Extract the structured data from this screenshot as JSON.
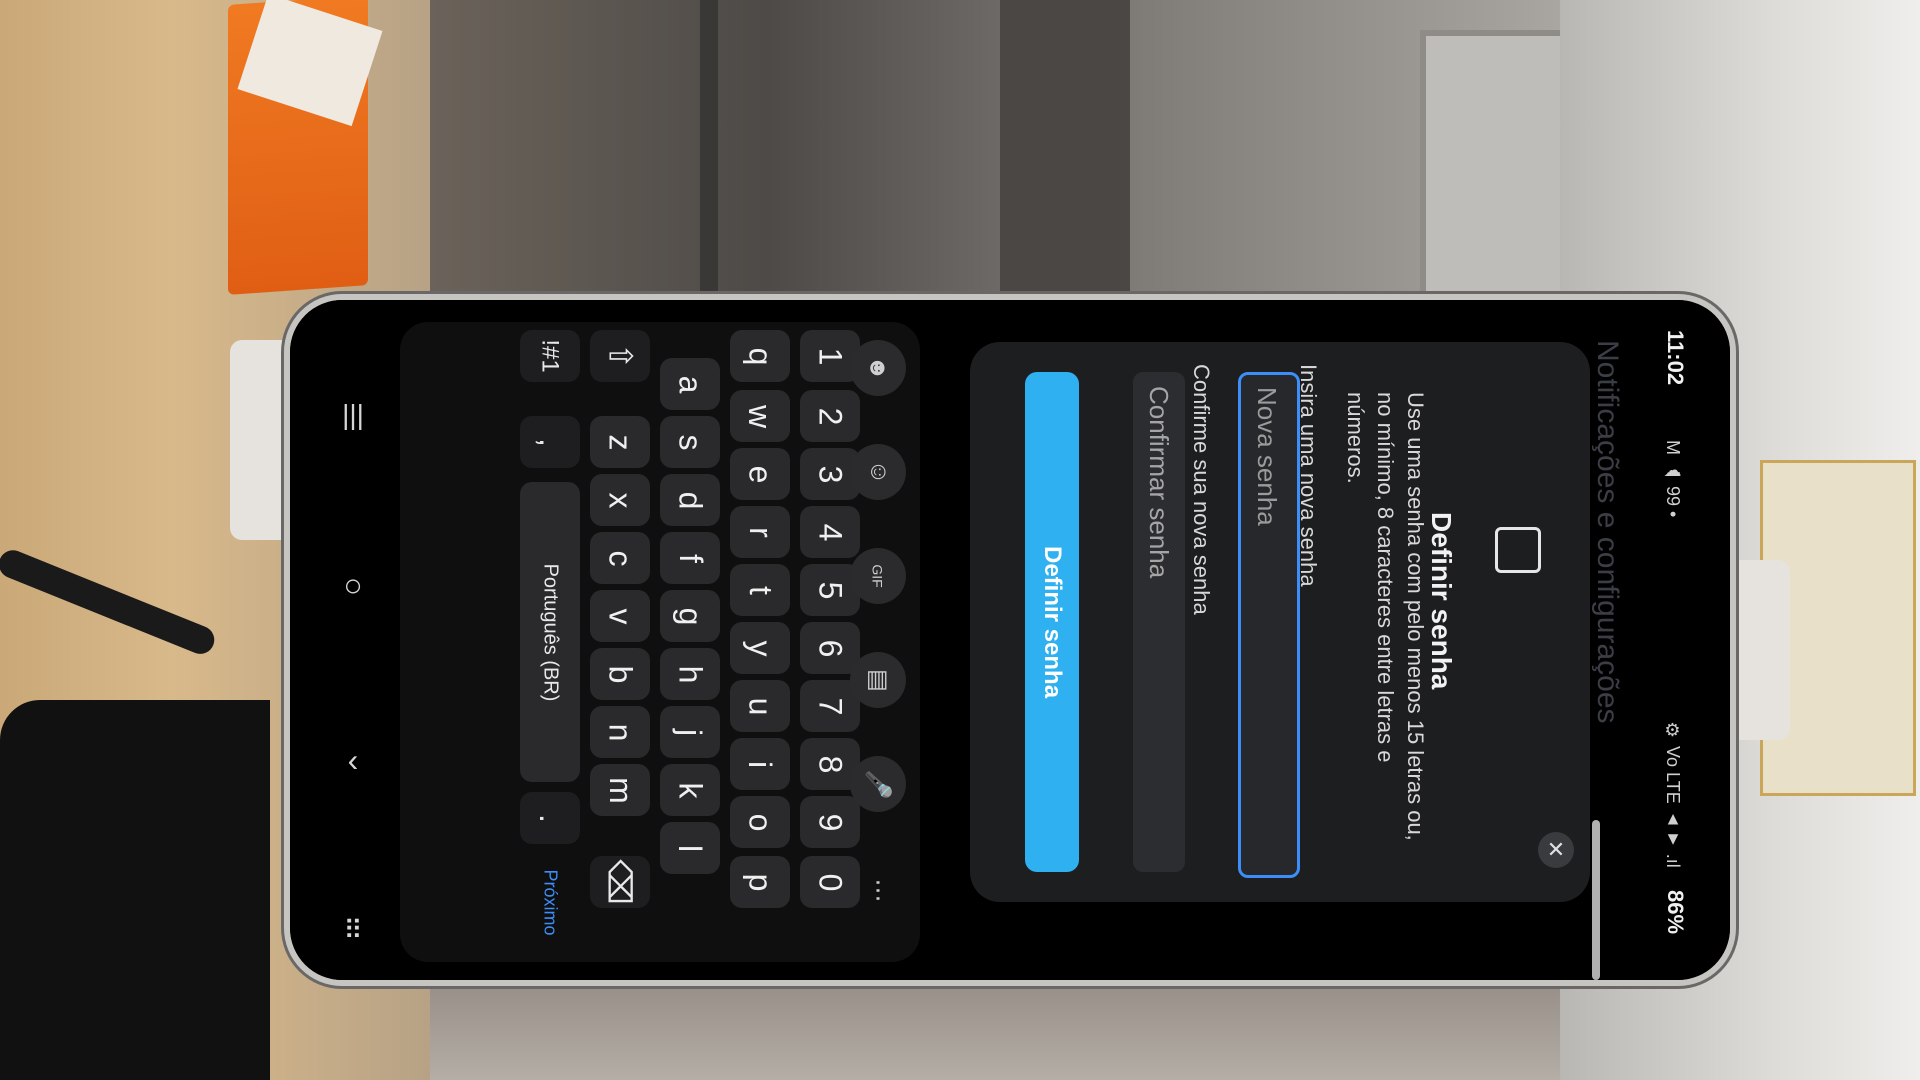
{
  "status_bar": {
    "time": "11:02",
    "left_icons": "M ☁ 99 •",
    "right_icons": "⚙ Vo LTE ▲▼ .ıl",
    "battery": "86%"
  },
  "background_header": "Notificações e configurações",
  "dialog": {
    "title": "Definir senha",
    "description": "Use uma senha com pelo menos 15 letras ou, no mínimo, 8 caracteres entre letras e números.",
    "new_password_label": "Insira uma nova senha",
    "new_password_placeholder": "Nova senha",
    "confirm_label": "Confirme sua nova senha",
    "confirm_placeholder": "Confirmar senha",
    "submit_label": "Definir senha",
    "close_glyph": "✕"
  },
  "keyboard": {
    "numbers": [
      "1",
      "2",
      "3",
      "4",
      "5",
      "6",
      "7",
      "8",
      "9",
      "0"
    ],
    "row1": [
      "q",
      "w",
      "e",
      "r",
      "t",
      "y",
      "u",
      "i",
      "o",
      "p"
    ],
    "row2": [
      "a",
      "s",
      "d",
      "f",
      "g",
      "h",
      "j",
      "k",
      "l"
    ],
    "row3": [
      "z",
      "x",
      "c",
      "v",
      "b",
      "n",
      "m"
    ],
    "symbols_key": "!#1",
    "comma_key": ",",
    "space_label": "Português (BR)",
    "period_key": ".",
    "next_label": "Próximo",
    "shift_glyph": "⇧",
    "backspace_glyph": "⌫"
  },
  "toolbar": {
    "emoji_glyph": "☻",
    "sticker_glyph": "☺",
    "gif_glyph": "GIF",
    "clipboard_glyph": "▤",
    "mic_glyph": "🎤",
    "more_glyph": "⋯"
  },
  "nav": {
    "recent_glyph": "|||",
    "home_glyph": "○",
    "back_glyph": "‹",
    "keyboard_glyph": "⠿"
  },
  "colors": {
    "accent": "#3d8ef8",
    "submit": "#2fb0f0",
    "dialog_bg": "#1d1e20"
  }
}
